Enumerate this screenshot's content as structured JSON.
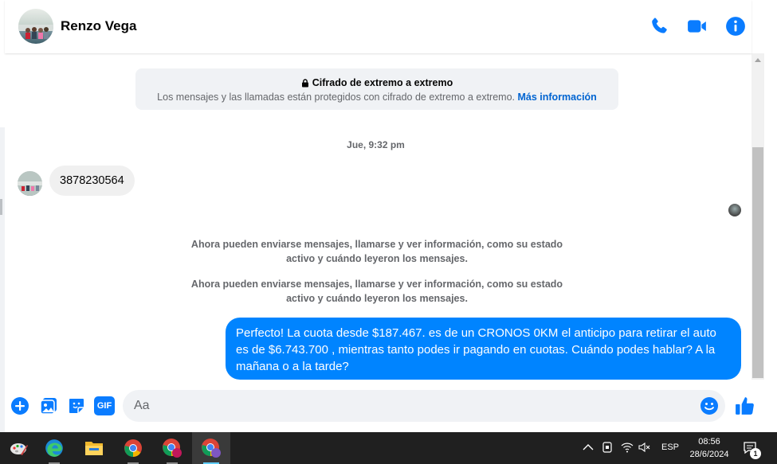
{
  "header": {
    "contact_name": "Renzo Vega",
    "icons": [
      "phone-icon",
      "video-camera-icon",
      "info-icon"
    ]
  },
  "encryption_notice": {
    "title": "Cifrado de extremo a extremo",
    "description": "Los mensajes y las llamadas están protegidos con cifrado de extremo a extremo.",
    "link": "Más información"
  },
  "conversation": {
    "timestamp": "Jue, 9:32 pm",
    "incoming_message": "3878230564",
    "system_messages": [
      {
        "line1": "Ahora pueden enviarse mensajes, llamarse y ver información, como su estado",
        "line2": "activo y cuándo leyeron los mensajes."
      },
      {
        "line1": "Ahora pueden enviarse mensajes, llamarse y ver información, como su estado",
        "line2": "activo y cuándo leyeron los mensajes."
      }
    ],
    "outgoing_message": "Perfecto! La cuota desde $187.467. es de un CRONOS 0KM el anticipo para retirar el auto es de $6.743.700 , mientras tanto podes ir pagando en cuotas. Cuándo podes hablar? A la mañana o a la tarde?"
  },
  "composer": {
    "placeholder": "Aa",
    "gif_label": "GIF",
    "icons": [
      "plus-icon",
      "image-icon",
      "sticker-icon",
      "gif-icon",
      "emoji-icon",
      "thumbs-up-icon"
    ]
  },
  "taskbar": {
    "apps": [
      "paint-icon",
      "edge-icon",
      "file-explorer-icon",
      "chrome-icon",
      "chrome-profile-icon",
      "chrome-profile-active-icon"
    ],
    "language": "ESP",
    "time": "08:56",
    "date": "28/6/2024",
    "notification_count": "1"
  },
  "colors": {
    "accent": "#0084ff",
    "header_icon": "#0a7cff",
    "taskbar": "#202020"
  }
}
